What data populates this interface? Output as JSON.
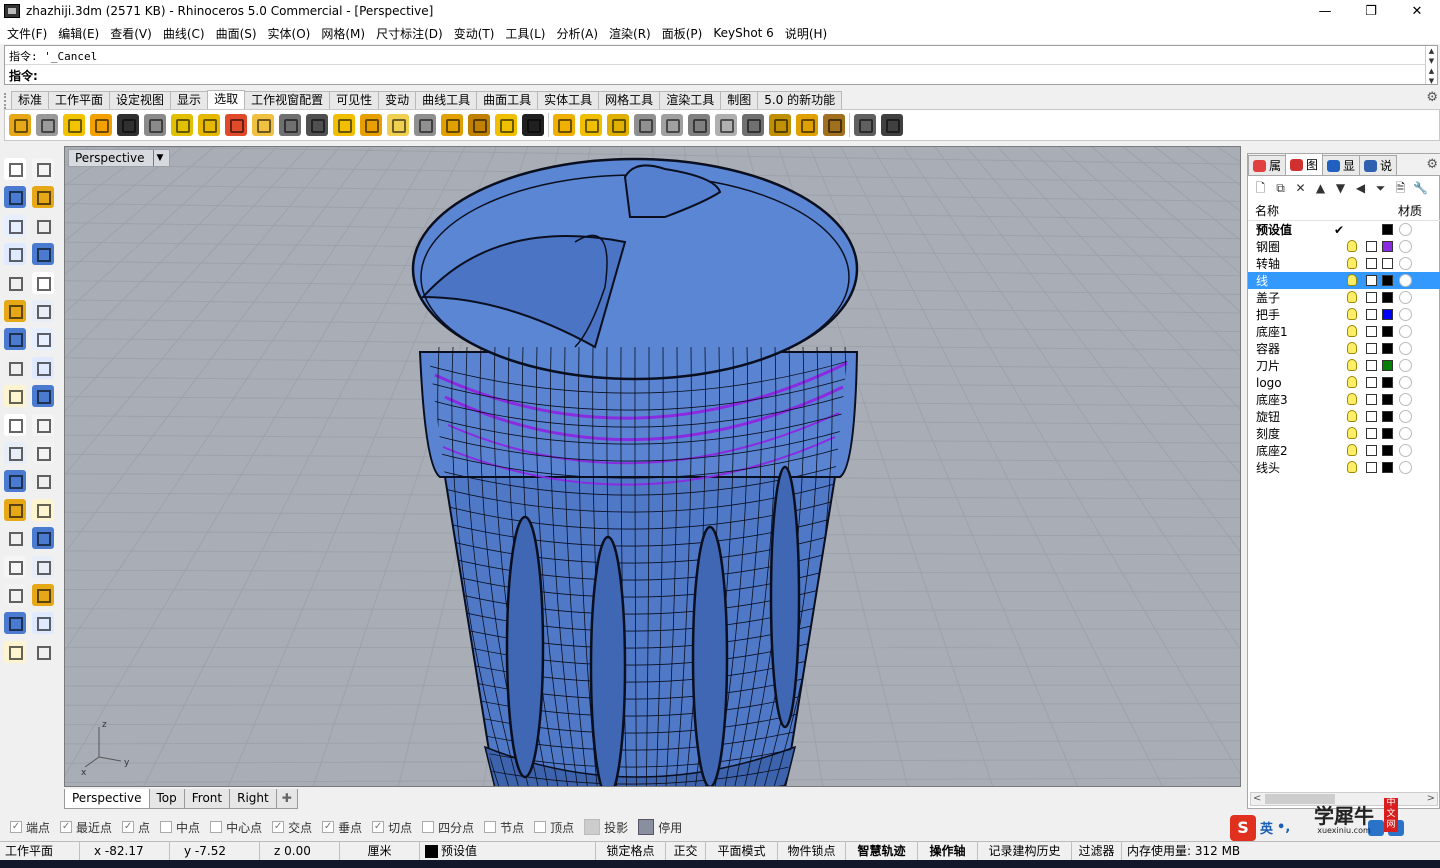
{
  "window": {
    "title": "zhazhiji.3dm (2571 KB) - Rhinoceros 5.0 Commercial - [Perspective]",
    "min": "—",
    "max": "❐",
    "close": "✕"
  },
  "menu": [
    "文件(F)",
    "编辑(E)",
    "查看(V)",
    "曲线(C)",
    "曲面(S)",
    "实体(O)",
    "网格(M)",
    "尺寸标注(D)",
    "变动(T)",
    "工具(L)",
    "分析(A)",
    "渲染(R)",
    "面板(P)",
    "KeyShot 6",
    "说明(H)"
  ],
  "command": {
    "history": "指令: '_Cancel",
    "prompt": "指令:",
    "value": ""
  },
  "tool_tabs": [
    "标准",
    "工作平面",
    "设定视图",
    "显示",
    "选取",
    "工作视窗配置",
    "可见性",
    "变动",
    "曲线工具",
    "曲面工具",
    "实体工具",
    "网格工具",
    "渲染工具",
    "制图",
    "5.0 的新功能"
  ],
  "active_tool_tab": 4,
  "toolbar_icons": [
    "select-points-icon",
    "select-lights-icon",
    "select-all-icon",
    "select-solids-icon",
    "select-curves-icon",
    "select-lines-icon",
    "select-text-icon",
    "select-surfaces-icon",
    "select-color-icon",
    "select-polysurface-icon",
    "select-dots-icon",
    "select-point-cloud-icon",
    "select-blocks-icon",
    "select-lights-2-icon",
    "select-hatch-icon",
    "select-control-points-icon",
    "select-annotation-icon",
    "select-by-layer-icon",
    "select-mesh-icon",
    "select-extrusion-icon",
    "select-planar-icon",
    "select-by-name-icon",
    "select-closed-icon",
    "select-open-icon",
    "select-chain-icon",
    "select-invert-icon",
    "select-sphere-icon",
    "select-box-icon",
    "select-object-icon",
    "select-material-icon",
    "select-brush-icon",
    "select-zoom-icon",
    "select-filter-icon"
  ],
  "toolbar_colors": [
    "#e6a817",
    "#9a9a9a",
    "#f2c300",
    "#f2a100",
    "#303030",
    "#8a8a8a",
    "#e0c000",
    "#e6b800",
    "#e04a2a",
    "#f0c040",
    "#707070",
    "#505050",
    "#f0c000",
    "#e8a000",
    "#f0d050",
    "#909090",
    "#e0a000",
    "#c08000",
    "#f0c000",
    "#202020",
    "#f0b000",
    "#f0c000",
    "#e0b000",
    "#909090",
    "#a0a0a0",
    "#808080",
    "#b0b0b0",
    "#707070",
    "#c09000",
    "#e0a000",
    "#a07020",
    "#606060",
    "#404040"
  ],
  "left_tools": [
    "pointer-icon",
    "point-icon",
    "polyline-icon",
    "curve-icon",
    "circle-icon",
    "ellipse-icon",
    "arc-icon",
    "rectangle-icon",
    "polygon-icon",
    "freeform-icon",
    "surface-icon",
    "revolve-icon",
    "box-icon",
    "sphere-icon",
    "cylinder-icon",
    "planar-surface-icon",
    "boolean-icon",
    "offset-icon",
    "extrude-icon",
    "split-icon",
    "fillet-icon",
    "trim-icon",
    "move-icon",
    "transform-icon",
    "text-icon",
    "scale-icon",
    "explode-icon",
    "group-icon",
    "dimension-icon",
    "hatch-icon",
    "array-icon",
    "properties-icon",
    "analyze-icon",
    "check-icon",
    "render-icon",
    "material-icon"
  ],
  "viewport": {
    "label": "Perspective",
    "axis_x": "x",
    "axis_y": "y",
    "axis_z": "z",
    "bg": "#a9aeb6",
    "model_color": "#4f78c7",
    "selection_color": "#8a2be2"
  },
  "view_tabs": [
    "Perspective",
    "Top",
    "Front",
    "Right"
  ],
  "active_view_tab": 0,
  "panel": {
    "tabs": [
      {
        "label": "属",
        "icon": "properties-icon"
      },
      {
        "label": "图",
        "icon": "layers-icon"
      },
      {
        "label": "显",
        "icon": "display-icon"
      },
      {
        "label": "说",
        "icon": "help-icon"
      }
    ],
    "active_tab": 1,
    "tools": [
      "new-layer-icon",
      "new-sublayer-icon",
      "delete-layer-icon",
      "move-up-icon",
      "move-down-icon",
      "parent-icon",
      "filter-icon",
      "print-icon",
      "tools-icon"
    ],
    "tool_glyphs": [
      "🗋",
      "⧉",
      "✕",
      "▲",
      "▼",
      "◀",
      "⏷",
      "🗎",
      "🔧"
    ],
    "header_name": "名称",
    "header_material": "材质",
    "layers": [
      {
        "name": "预设值",
        "color": "#000000",
        "current": true,
        "check": "✔"
      },
      {
        "name": "钢圈",
        "color": "#8a2be2"
      },
      {
        "name": "转轴",
        "color": "#ffffff"
      },
      {
        "name": "线",
        "color": "#000000",
        "selected": true
      },
      {
        "name": "盖子",
        "color": "#000000"
      },
      {
        "name": "把手",
        "color": "#0000ff"
      },
      {
        "name": "底座1",
        "color": "#000000"
      },
      {
        "name": "容器",
        "color": "#000000"
      },
      {
        "name": "刀片",
        "color": "#008000"
      },
      {
        "name": "logo",
        "color": "#000000"
      },
      {
        "name": "底座3",
        "color": "#000000"
      },
      {
        "name": "旋钮",
        "color": "#000000"
      },
      {
        "name": "刻度",
        "color": "#000000"
      },
      {
        "name": "底座2",
        "color": "#000000"
      },
      {
        "name": "线头",
        "color": "#000000"
      }
    ],
    "scroll_left": "<",
    "scroll_right": ">"
  },
  "osnaps": [
    {
      "label": "端点",
      "checked": true
    },
    {
      "label": "最近点",
      "checked": true
    },
    {
      "label": "点",
      "checked": true
    },
    {
      "label": "中点",
      "checked": false
    },
    {
      "label": "中心点",
      "checked": false
    },
    {
      "label": "交点",
      "checked": true
    },
    {
      "label": "垂点",
      "checked": true
    },
    {
      "label": "切点",
      "checked": true
    },
    {
      "label": "四分点",
      "checked": false
    },
    {
      "label": "节点",
      "checked": false
    },
    {
      "label": "顶点",
      "checked": false
    },
    {
      "label": "投影",
      "style": "gray"
    },
    {
      "label": "停用",
      "style": "dis"
    }
  ],
  "status": {
    "cplane": "工作平面",
    "x": "x -82.17",
    "y": "y -7.52",
    "z": "z 0.00",
    "units": "厘米",
    "layer": "预设值",
    "grid_snap": "锁定格点",
    "ortho": "正交",
    "planar": "平面模式",
    "osnap": "物件锁点",
    "smarttrack": "智慧轨迹",
    "gumball": "操作轴",
    "history": "记录建构历史",
    "filter": "过滤器",
    "memory": "内存使用量: 312 MB"
  },
  "ime": {
    "logo": "S",
    "lang": "英",
    "punct": "•,",
    "watermark": "学犀牛",
    "watermark_url": "xuexiniu.com",
    "watermark_tag": "中文网"
  }
}
